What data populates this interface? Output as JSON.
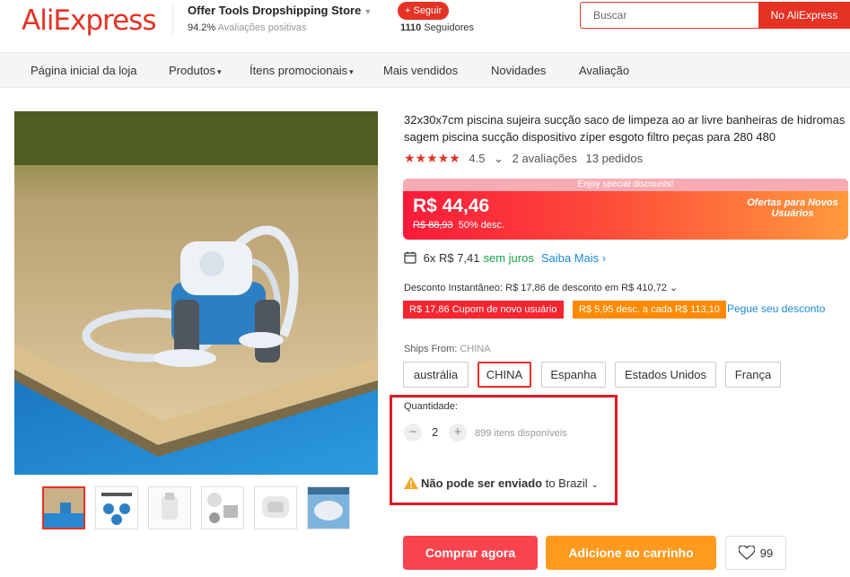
{
  "header": {
    "logo": "AliExpress",
    "store_name": "Offer Tools Dropshipping Store",
    "store_rating_value": "94.2%",
    "store_rating_text": "Avaliações positivas",
    "follow_label": "+ Seguir",
    "followers_count": "1110",
    "followers_text": "Seguidores",
    "search_placeholder": "Buscar",
    "search_button": "No AliExpress"
  },
  "nav": {
    "items": [
      {
        "label": "Página inicial da loja"
      },
      {
        "label": "Produtos"
      },
      {
        "label": "Ítens promocionais"
      },
      {
        "label": "Mais vendidos"
      },
      {
        "label": "Novidades"
      },
      {
        "label": "Avaliação"
      }
    ]
  },
  "product": {
    "title_line1": "32x30x7cm piscina sujeira sucção saco de limpeza ao ar livre banheiras de hidromas",
    "title_line2": "sagem piscina sucção dispositivo zíper esgoto filtro peças para 280 480",
    "rating": "4.5",
    "reviews": "2 avaliações",
    "orders": "13 pedidos",
    "price_banner": "Enjoy special discounts!",
    "price": "R$ 44,46",
    "old_price": "R$ 88,93",
    "discount": "50% desc.",
    "promo_label": "Ofertas para Novos Usuários",
    "installments": "6x R$ 7,41",
    "installments_interest": "sem juros",
    "installments_link": "Saiba Mais",
    "instant_discount": "Desconto Instantâneo: R$ 17,86 de desconto em R$ 410,72",
    "coupon1": "R$ 17,86 Cupom de novo usuário",
    "coupon2": "R$ 5,95 desc. a cada R$ 113,10",
    "coupon_link": "Pegue seu desconto",
    "ships_from_label": "Ships From:",
    "ships_from_value": "CHINA",
    "ship_options": [
      "austrália",
      "CHINA",
      "Espanha",
      "Estados Unidos",
      "França"
    ],
    "quantity_label": "Quantidade:",
    "quantity": "2",
    "available": "899 itens disponíveis",
    "ship_warning_bold": "Não pode ser enviado",
    "ship_warning_rest": "to Brazil",
    "buy_now": "Comprar agora",
    "add_to_cart": "Adicione ao carrinho",
    "wishlist_count": "99"
  },
  "colors": {
    "brand": "#e43225",
    "buy": "#f9444d",
    "cart": "#ff9a1f",
    "link": "#1a8ad8",
    "highlight_box": "#e01a25"
  }
}
